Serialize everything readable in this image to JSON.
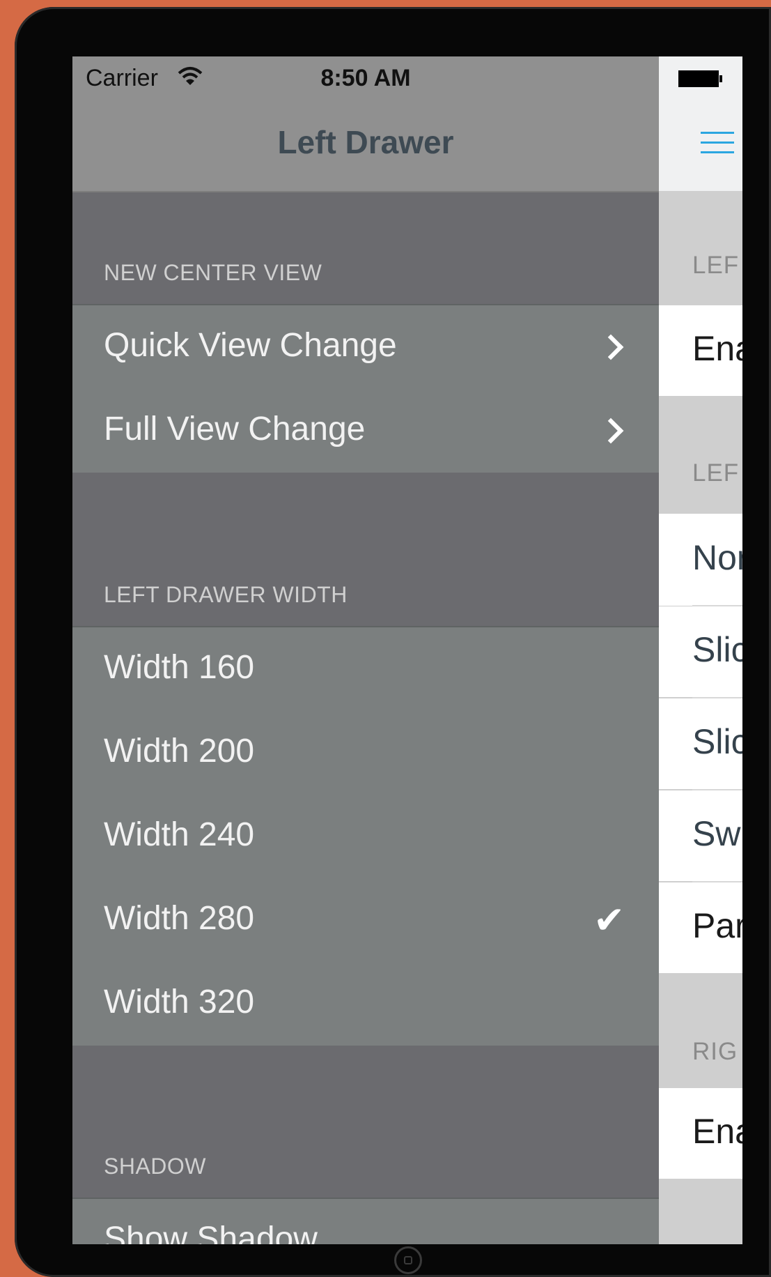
{
  "status_bar": {
    "carrier": "Carrier",
    "time": "8:50 AM"
  },
  "drawer": {
    "title": "Left Drawer",
    "sections": [
      {
        "header": "NEW CENTER VIEW",
        "rows": [
          {
            "label": "Quick View Change",
            "accessory": "chevron"
          },
          {
            "label": "Full View Change",
            "accessory": "chevron"
          }
        ]
      },
      {
        "header": "LEFT DRAWER WIDTH",
        "rows": [
          {
            "label": "Width 160",
            "accessory": "none"
          },
          {
            "label": "Width 200",
            "accessory": "none"
          },
          {
            "label": "Width 240",
            "accessory": "none"
          },
          {
            "label": "Width 280",
            "accessory": "checkmark",
            "selected": true
          },
          {
            "label": "Width 320",
            "accessory": "none"
          }
        ]
      },
      {
        "header": "SHADOW",
        "rows": [
          {
            "label": "Show Shadow",
            "accessory": "none"
          }
        ]
      }
    ]
  },
  "center": {
    "menu_icon": "hamburger-icon",
    "sections": [
      {
        "header": "LEF",
        "rows": [
          "Ena"
        ]
      },
      {
        "header": "LEF",
        "rows": [
          "Nor",
          "Slic",
          "Slic",
          "Sw",
          "Par"
        ]
      },
      {
        "header": "RIG",
        "rows": [
          "Ena"
        ]
      }
    ]
  },
  "colors": {
    "background": "#d56a45",
    "drawer_background": "#6b6b6f",
    "drawer_cell": "#7b7f7f",
    "drawer_nav": "#909090",
    "accent": "#2ba6e0",
    "title": "#3e4a53"
  }
}
